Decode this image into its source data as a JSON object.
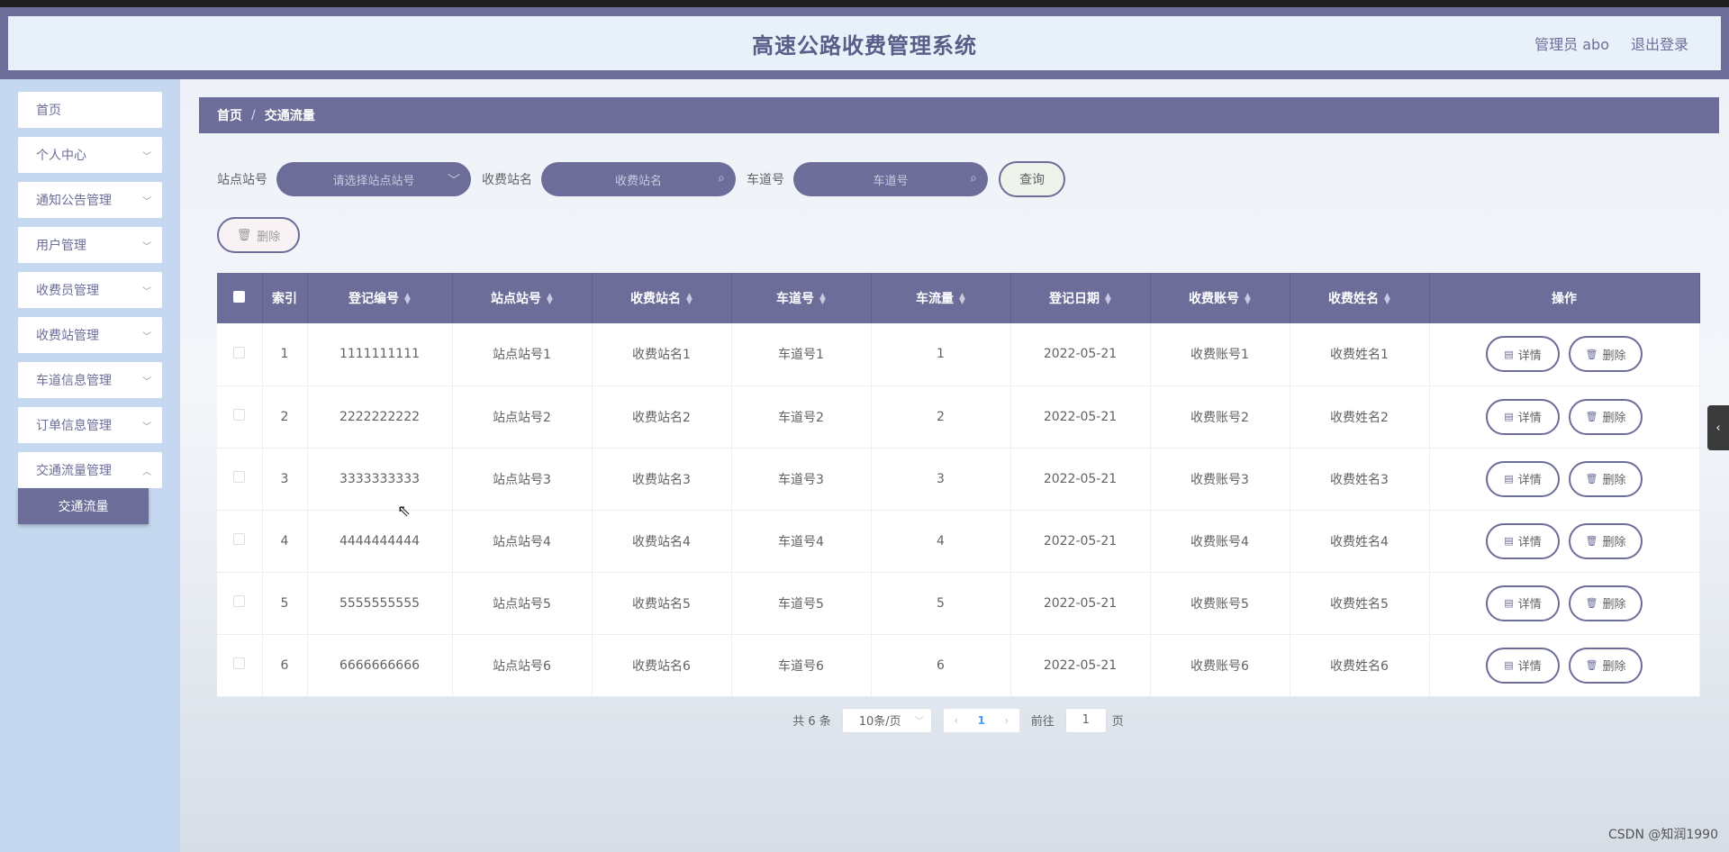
{
  "header": {
    "title": "高速公路收费管理系统",
    "user": "管理员 abo",
    "logout": "退出登录"
  },
  "sidebar": {
    "items": [
      {
        "label": "首页",
        "has_children": false
      },
      {
        "label": "个人中心",
        "has_children": true
      },
      {
        "label": "通知公告管理",
        "has_children": true
      },
      {
        "label": "用户管理",
        "has_children": true
      },
      {
        "label": "收费员管理",
        "has_children": true
      },
      {
        "label": "收费站管理",
        "has_children": true
      },
      {
        "label": "车道信息管理",
        "has_children": true
      },
      {
        "label": "订单信息管理",
        "has_children": true
      },
      {
        "label": "交通流量管理",
        "has_children": true
      }
    ],
    "active_sub": "交通流量"
  },
  "breadcrumb": {
    "home": "首页",
    "current": "交通流量",
    "separator": "/"
  },
  "search": {
    "station_no_label": "站点站号",
    "station_no_placeholder": "请选择站点站号",
    "station_name_label": "收费站名",
    "station_name_placeholder": "收费站名",
    "lane_label": "车道号",
    "lane_placeholder": "车道号",
    "query_button": "查询"
  },
  "bulk_delete": "删除",
  "table": {
    "columns": [
      "索引",
      "登记编号",
      "站点站号",
      "收费站名",
      "车道号",
      "车流量",
      "登记日期",
      "收费账号",
      "收费姓名",
      "操作"
    ],
    "detail_label": "详情",
    "delete_label": "删除",
    "rows": [
      {
        "index": "1",
        "reg_no": "1111111111",
        "station_no": "站点站号1",
        "station_name": "收费站名1",
        "lane": "车道号1",
        "flow": "1",
        "date": "2022-05-21",
        "account": "收费账号1",
        "name": "收费姓名1"
      },
      {
        "index": "2",
        "reg_no": "2222222222",
        "station_no": "站点站号2",
        "station_name": "收费站名2",
        "lane": "车道号2",
        "flow": "2",
        "date": "2022-05-21",
        "account": "收费账号2",
        "name": "收费姓名2"
      },
      {
        "index": "3",
        "reg_no": "3333333333",
        "station_no": "站点站号3",
        "station_name": "收费站名3",
        "lane": "车道号3",
        "flow": "3",
        "date": "2022-05-21",
        "account": "收费账号3",
        "name": "收费姓名3"
      },
      {
        "index": "4",
        "reg_no": "4444444444",
        "station_no": "站点站号4",
        "station_name": "收费站名4",
        "lane": "车道号4",
        "flow": "4",
        "date": "2022-05-21",
        "account": "收费账号4",
        "name": "收费姓名4"
      },
      {
        "index": "5",
        "reg_no": "5555555555",
        "station_no": "站点站号5",
        "station_name": "收费站名5",
        "lane": "车道号5",
        "flow": "5",
        "date": "2022-05-21",
        "account": "收费账号5",
        "name": "收费姓名5"
      },
      {
        "index": "6",
        "reg_no": "6666666666",
        "station_no": "站点站号6",
        "station_name": "收费站名6",
        "lane": "车道号6",
        "flow": "6",
        "date": "2022-05-21",
        "account": "收费账号6",
        "name": "收费姓名6"
      }
    ]
  },
  "pagination": {
    "total_text": "共 6 条",
    "page_size": "10条/页",
    "current_page": "1",
    "goto_label": "前往",
    "goto_value": "1",
    "page_suffix": "页"
  },
  "watermark": "CSDN @知润1990",
  "colors": {
    "primary": "#6c6d98",
    "sidebar_bg": "#c5d8ef",
    "header_bg": "#e8f1fa"
  }
}
